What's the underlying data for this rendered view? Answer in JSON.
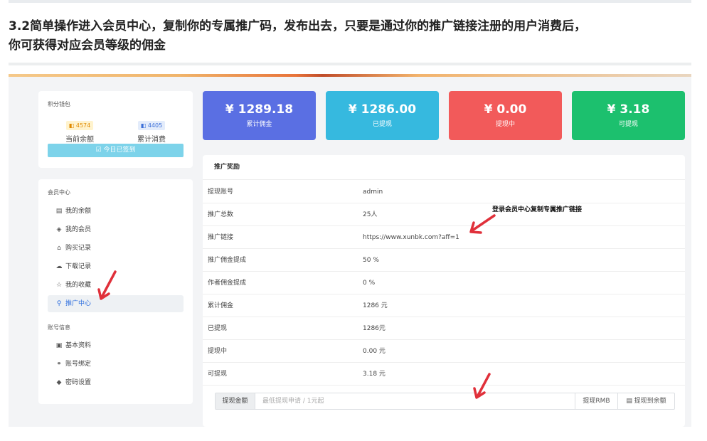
{
  "heading": {
    "line1": "3.2简单操作进入会员中心，复制你的专属推广码，发布出去，只要是通过你的推广链接注册的用户消费后，",
    "line2": "你可获得对应会员等级的佣金"
  },
  "wallet": {
    "title": "积分钱包",
    "balance_value": "4574",
    "balance_label": "当前余额",
    "spent_value": "4405",
    "spent_label": "累计消费",
    "sign_button": "☑ 今日已签到"
  },
  "member_center": {
    "title": "会员中心",
    "items": [
      {
        "icon": "wallet-icon",
        "glyph": "▤",
        "label": "我的余额"
      },
      {
        "icon": "diamond-icon",
        "glyph": "◈",
        "label": "我的会员"
      },
      {
        "icon": "basket-icon",
        "glyph": "⌂",
        "label": "购买记录"
      },
      {
        "icon": "cloud-download-icon",
        "glyph": "☁",
        "label": "下载记录"
      },
      {
        "icon": "star-icon",
        "glyph": "☆",
        "label": "我的收藏"
      },
      {
        "icon": "hand-coin-icon",
        "glyph": "⚲",
        "label": "推广中心"
      }
    ]
  },
  "account_info": {
    "title": "账号信息",
    "items": [
      {
        "icon": "id-card-icon",
        "glyph": "▣",
        "label": "基本资料"
      },
      {
        "icon": "link-account-icon",
        "glyph": "⚭",
        "label": "账号绑定"
      },
      {
        "icon": "shield-icon",
        "glyph": "◆",
        "label": "密码设置"
      }
    ]
  },
  "kpis": [
    {
      "value": "¥ 1289.18",
      "label": "累计佣金",
      "color": "#5a6fe3"
    },
    {
      "value": "¥ 1286.00",
      "label": "已提现",
      "color": "#36b9df"
    },
    {
      "value": "¥ 0.00",
      "label": "提现中",
      "color": "#f25a5a"
    },
    {
      "value": "¥ 3.18",
      "label": "可提现",
      "color": "#1cc06e"
    }
  ],
  "panel": {
    "title": "推广奖励",
    "rows": [
      {
        "key": "提现账号",
        "value": "admin"
      },
      {
        "key": "推广总数",
        "value": "25人"
      },
      {
        "key": "推广链接",
        "value": "https://www.xunbk.com?aff=1"
      },
      {
        "key": "推广佣金提成",
        "value": "50 %"
      },
      {
        "key": "作者佣金提成",
        "value": "0 %"
      },
      {
        "key": "累计佣金",
        "value": "1286 元"
      },
      {
        "key": "已提现",
        "value": "1286元"
      },
      {
        "key": "提现中",
        "value": "0.00 元"
      },
      {
        "key": "可提现",
        "value": "3.18 元"
      }
    ]
  },
  "annotation": "登录会员中心复制专属推广链接",
  "withdraw": {
    "label": "提现金额",
    "placeholder": "最低提现申请 / 1元起",
    "button_rmb": "提现RMB",
    "button_balance": "▤ 提现到余额"
  },
  "colors": {
    "arrow": "#e0303a",
    "active": "#2f6fde"
  }
}
